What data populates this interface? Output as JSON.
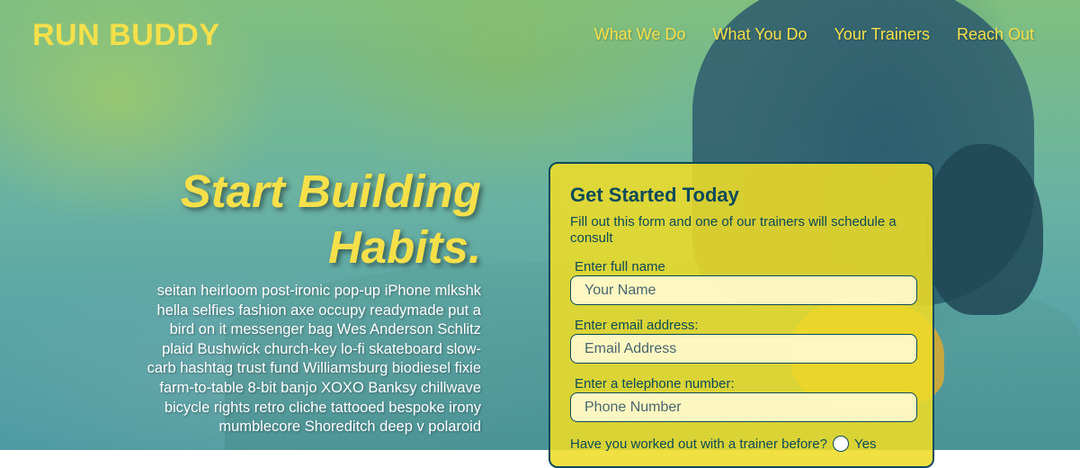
{
  "header": {
    "logo": "RUN BUDDY",
    "nav": [
      {
        "label": "What We Do"
      },
      {
        "label": "What You Do"
      },
      {
        "label": "Your Trainers"
      },
      {
        "label": "Reach Out"
      }
    ]
  },
  "hero": {
    "title_line1": "Start Building",
    "title_line2": "Habits.",
    "body": "seitan heirloom post-ironic pop-up iPhone mlkshk hella selfies fashion axe occupy readymade put a bird on it messenger bag Wes Anderson Schlitz plaid Bushwick church-key lo-fi skateboard slow-carb hashtag trust fund Williamsburg biodiesel fixie farm-to-table 8-bit banjo XOXO Banksy chillwave bicycle rights retro cliche tattooed bespoke irony mumblecore Shoreditch deep v polaroid"
  },
  "form": {
    "title": "Get Started Today",
    "subtitle": "Fill out this form and one of our trainers will schedule a consult",
    "fields": [
      {
        "label": "Enter full name",
        "placeholder": "Your Name",
        "value": ""
      },
      {
        "label": "Enter email address:",
        "placeholder": "Email Address",
        "value": ""
      },
      {
        "label": "Enter a telephone number:",
        "placeholder": "Phone Number",
        "value": ""
      }
    ],
    "question": "Have you worked out with a trainer before?",
    "option_yes": "Yes"
  },
  "colors": {
    "accent": "#f5e04a",
    "dark": "#0c4a5a"
  }
}
